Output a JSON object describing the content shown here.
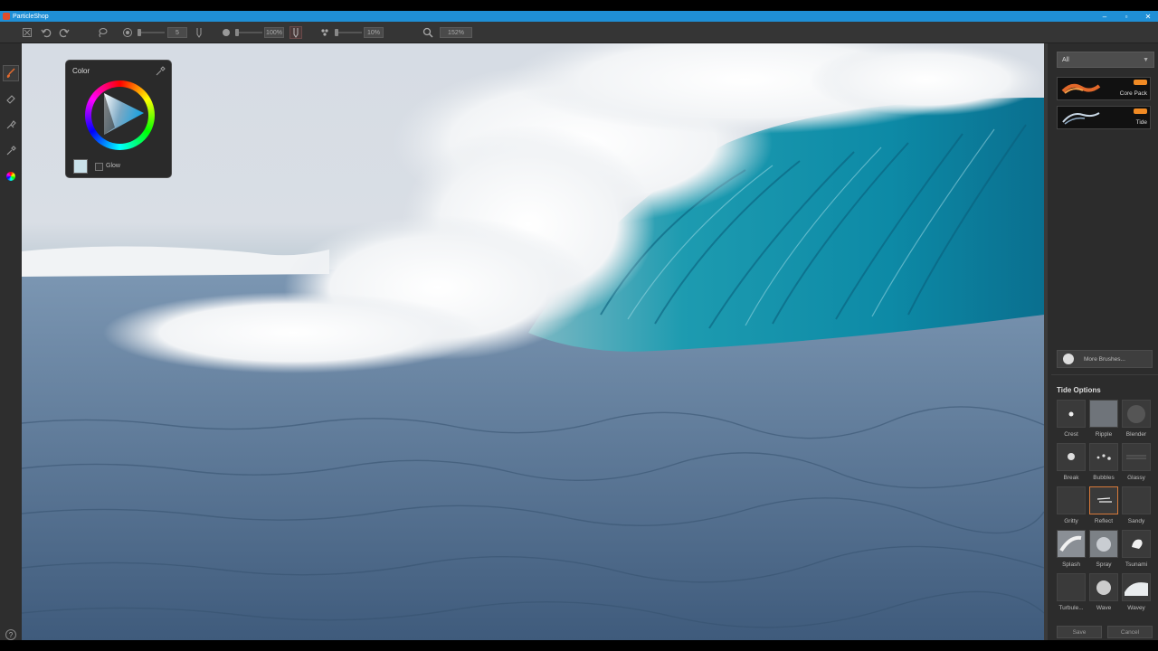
{
  "window": {
    "title": "ParticleShop",
    "minimize": "–",
    "maximize": "▫",
    "close": "✕"
  },
  "toolbar": {
    "size_value": "5",
    "opacity_value": "100%",
    "flow_value": "10%",
    "zoom_value": "152%"
  },
  "color_panel": {
    "title": "Color",
    "glow_label": "Glow",
    "swatch_color": "#c9e1ea"
  },
  "right_panel": {
    "category_select": "All",
    "packs": [
      {
        "label": "Core Pack"
      },
      {
        "label": "Tide"
      }
    ],
    "more_brushes": "More Brushes...",
    "options_title": "Tide Options",
    "brushes": [
      {
        "label": "Crest"
      },
      {
        "label": "Ripple"
      },
      {
        "label": "Blender"
      },
      {
        "label": "Break"
      },
      {
        "label": "Bubbles"
      },
      {
        "label": "Glassy"
      },
      {
        "label": "Gritty"
      },
      {
        "label": "Reflect"
      },
      {
        "label": "Sandy"
      },
      {
        "label": "Splash"
      },
      {
        "label": "Spray"
      },
      {
        "label": "Tsunami"
      },
      {
        "label": "Turbule..."
      },
      {
        "label": "Wave"
      },
      {
        "label": "Wavey"
      }
    ],
    "selected_brush": "Reflect",
    "save_label": "Save",
    "cancel_label": "Cancel"
  },
  "help_label": "?"
}
